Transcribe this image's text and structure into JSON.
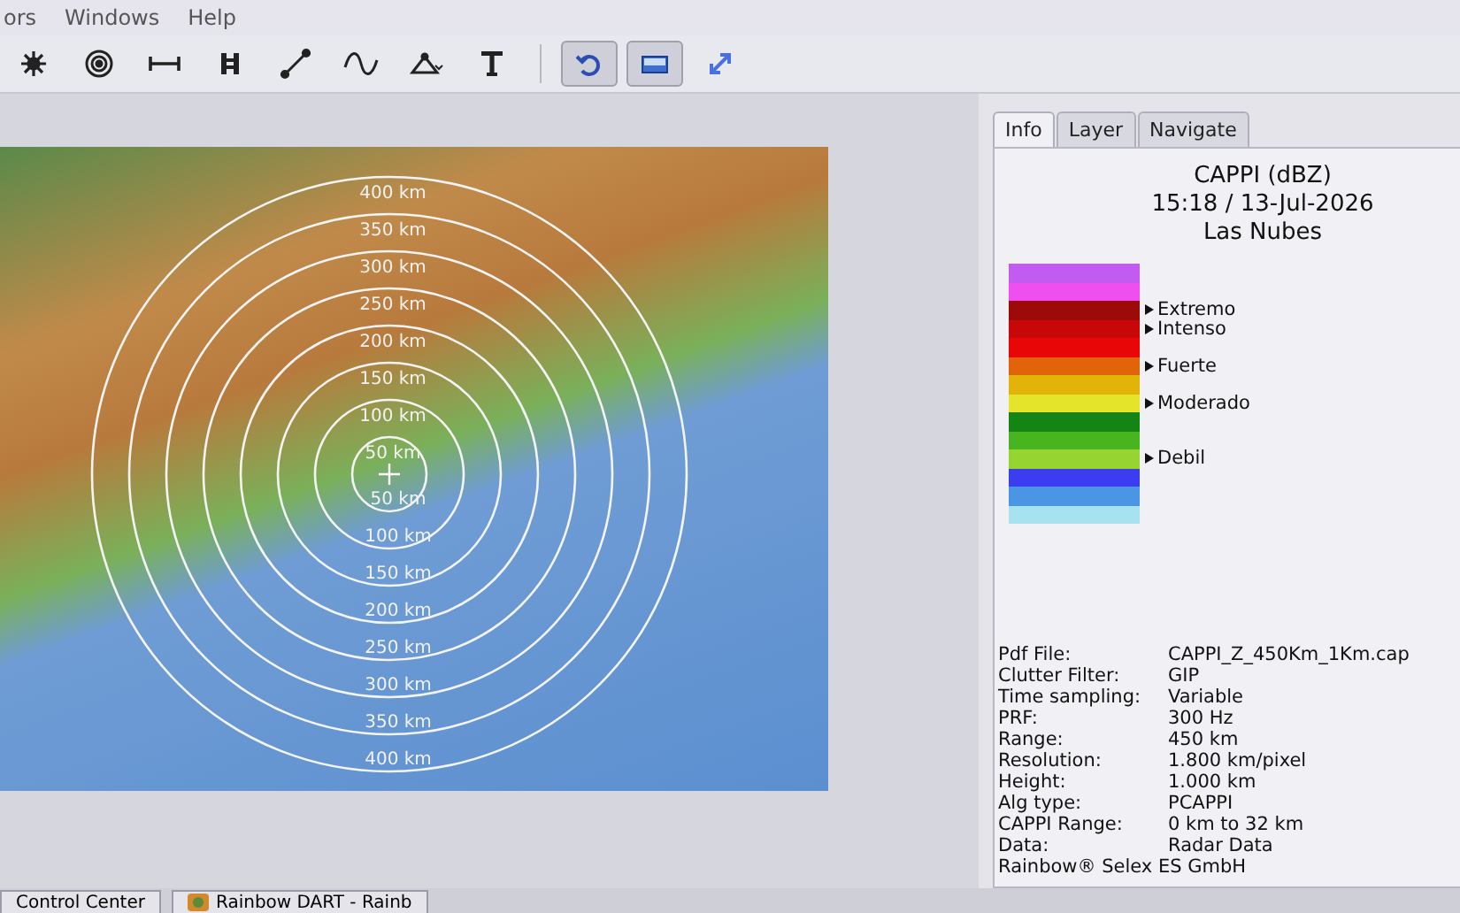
{
  "menubar": {
    "items": [
      {
        "label": "ors"
      },
      {
        "label": "Windows"
      },
      {
        "label": "Help"
      }
    ]
  },
  "toolbar": {
    "tools": [
      {
        "kind": "sun"
      },
      {
        "kind": "target"
      },
      {
        "kind": "distance"
      },
      {
        "kind": "columns"
      },
      {
        "kind": "diagonal"
      },
      {
        "kind": "wave"
      },
      {
        "kind": "triangle"
      },
      {
        "kind": "text"
      }
    ],
    "view_buttons": [
      {
        "kind": "undo",
        "pressed": true
      },
      {
        "kind": "window",
        "pressed": true
      },
      {
        "kind": "expand",
        "pressed": false
      }
    ]
  },
  "map": {
    "range_labels_north": [
      "400 km",
      "350 km",
      "300 km",
      "250 km",
      "200 km",
      "150 km",
      "100 km",
      "50 km"
    ],
    "range_labels_south": [
      "50 km",
      "100 km",
      "150 km",
      "200 km",
      "250 km",
      "300 km",
      "350 km",
      "400 km"
    ]
  },
  "tabs": [
    {
      "label": "Info",
      "selected": true
    },
    {
      "label": "Layer",
      "selected": false
    },
    {
      "label": "Navigate",
      "selected": false
    }
  ],
  "info": {
    "title": "CAPPI (dBZ)",
    "datetime": "15:18 / 13-Jul-2026",
    "site": "Las Nubes"
  },
  "legend": [
    {
      "color": "#c25cf0"
    },
    {
      "color": "#f04ff0"
    },
    {
      "color": "#9c0a0a",
      "label": "Extremo"
    },
    {
      "color": "#c80808",
      "label": "Intenso"
    },
    {
      "color": "#e80606"
    },
    {
      "color": "#e2640a",
      "label": "Fuerte"
    },
    {
      "color": "#e2b40a"
    },
    {
      "color": "#e4e42a",
      "label": "Moderado"
    },
    {
      "color": "#148414"
    },
    {
      "color": "#48b420"
    },
    {
      "color": "#96d432",
      "label": "Debil"
    },
    {
      "color": "#3c3cf0"
    },
    {
      "color": "#4a96e4"
    },
    {
      "color": "#a6e2f0"
    }
  ],
  "details": [
    {
      "label": "Pdf File:",
      "value": "CAPPI_Z_450Km_1Km.cap"
    },
    {
      "label": "Clutter Filter:",
      "value": "GIP"
    },
    {
      "label": "Time sampling:",
      "value": "Variable"
    },
    {
      "label": "PRF:",
      "value": "300 Hz"
    },
    {
      "label": "Range:",
      "value": "450 km"
    },
    {
      "label": "Resolution:",
      "value": "1.800 km/pixel"
    },
    {
      "label": "Height:",
      "value": "1.000 km"
    },
    {
      "label": "Alg type:",
      "value": "PCAPPI"
    },
    {
      "label": "CAPPI Range:",
      "value": "0 km to 32 km"
    },
    {
      "label": "Data:",
      "value": "Radar Data"
    }
  ],
  "footer": "Rainbow® Selex ES GmbH",
  "taskbar": [
    {
      "label": "Control Center",
      "icon": false
    },
    {
      "label": "Rainbow DART - Rainb",
      "icon": true
    }
  ]
}
